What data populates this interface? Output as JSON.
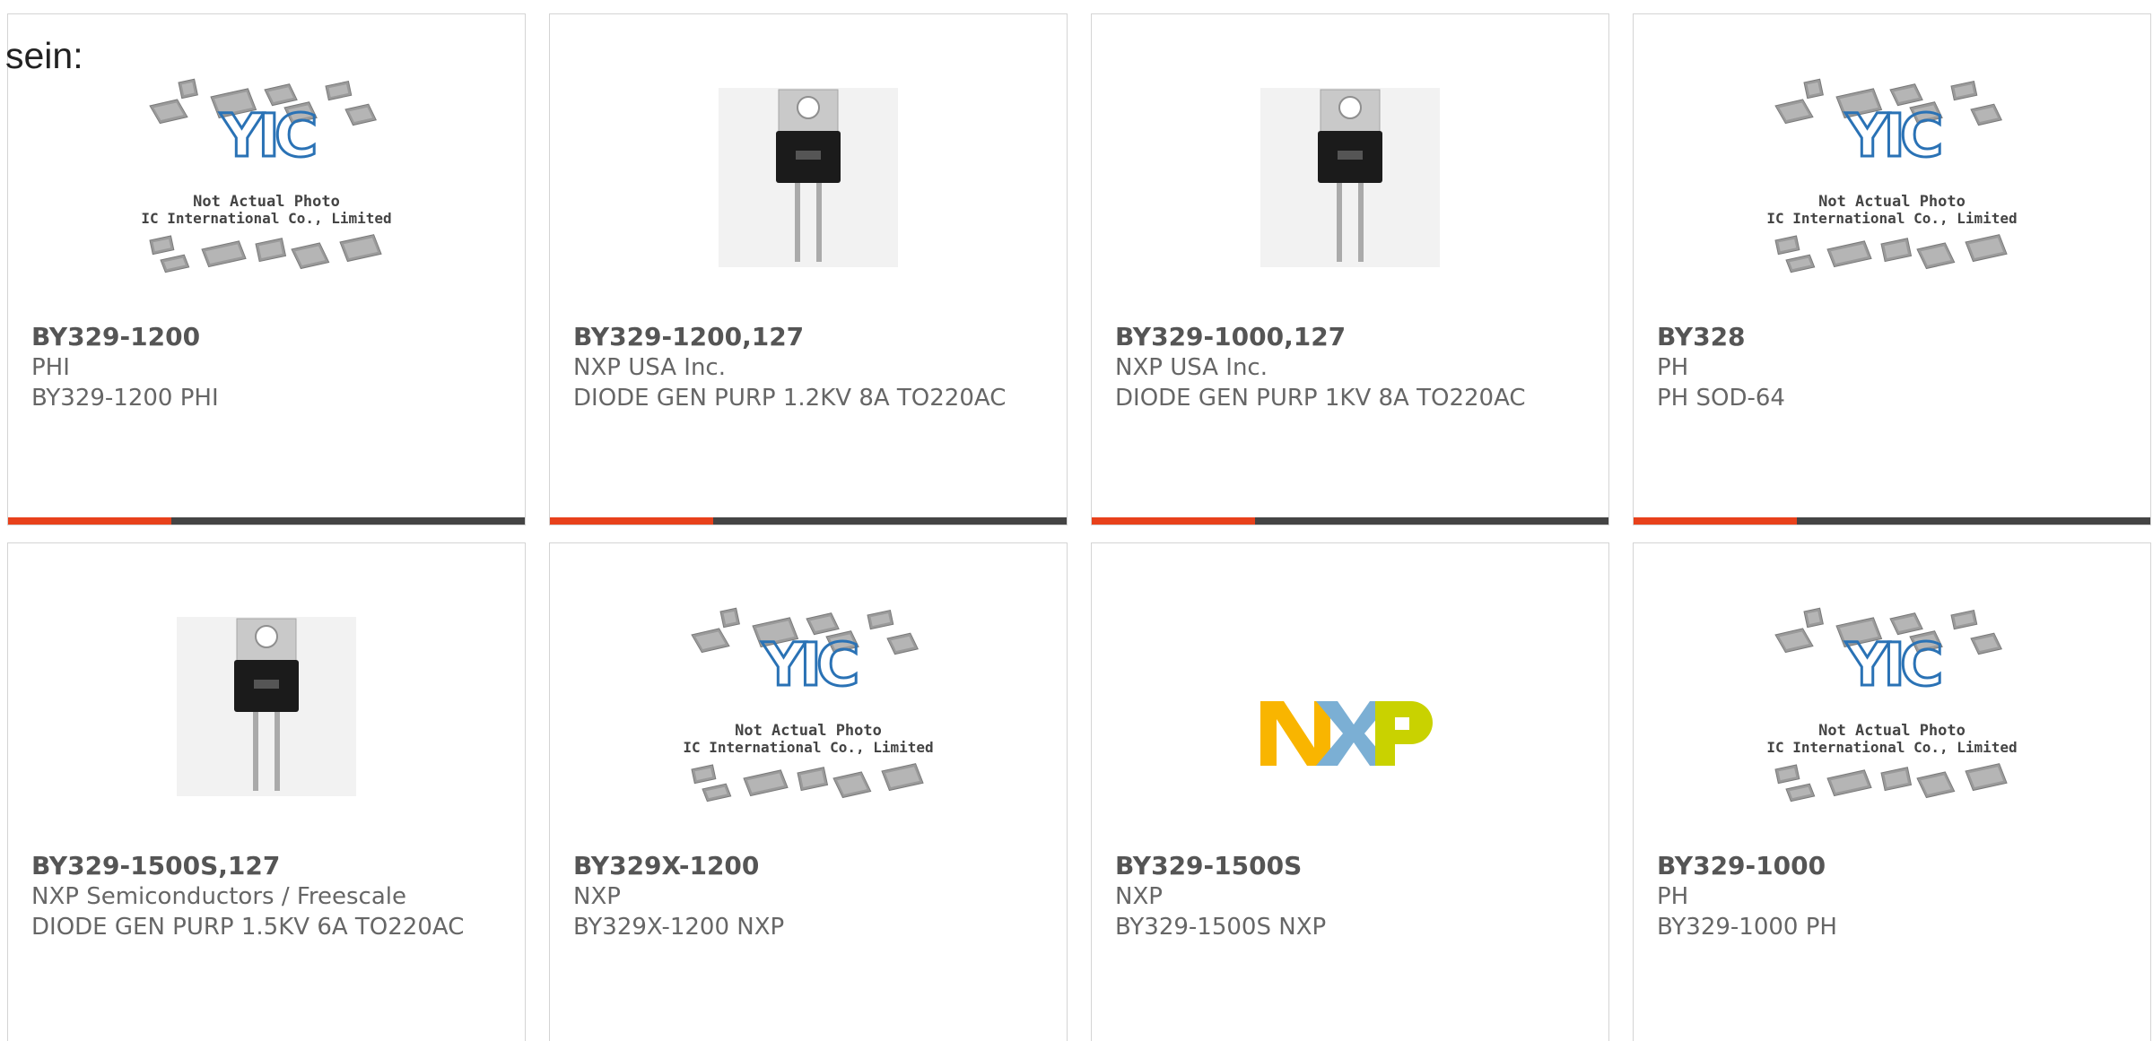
{
  "intro_text": "sein:",
  "placeholder_text": {
    "line1": "Not Actual Photo",
    "line2": "YIC International Co., Limited.",
    "logo": "YIC"
  },
  "nxp_logo_text": "NXP",
  "colors": {
    "accent": "#e8411b",
    "bar": "#444444",
    "text": "#666666",
    "yic_blue": "#2a72b5"
  },
  "products": [
    {
      "part": "BY329-1200",
      "maker": "PHI",
      "desc": "BY329-1200 PHI",
      "image": "placeholder"
    },
    {
      "part": "BY329-1200,127",
      "maker": "NXP USA Inc.",
      "desc": "DIODE GEN PURP 1.2KV 8A TO220AC",
      "image": "transistor"
    },
    {
      "part": "BY329-1000,127",
      "maker": "NXP USA Inc.",
      "desc": "DIODE GEN PURP 1KV 8A TO220AC",
      "image": "transistor"
    },
    {
      "part": "BY328",
      "maker": "PH",
      "desc": "PH SOD-64",
      "image": "placeholder"
    },
    {
      "part": "BY329-1500S,127",
      "maker": "NXP Semiconductors / Freescale",
      "desc": "DIODE GEN PURP 1.5KV 6A TO220AC",
      "image": "transistor"
    },
    {
      "part": "BY329X-1200",
      "maker": "NXP",
      "desc": "BY329X-1200 NXP",
      "image": "placeholder"
    },
    {
      "part": "BY329-1500S",
      "maker": "NXP",
      "desc": "BY329-1500S NXP",
      "image": "nxp-logo"
    },
    {
      "part": "BY329-1000",
      "maker": "PH",
      "desc": "BY329-1000 PH",
      "image": "placeholder"
    }
  ]
}
